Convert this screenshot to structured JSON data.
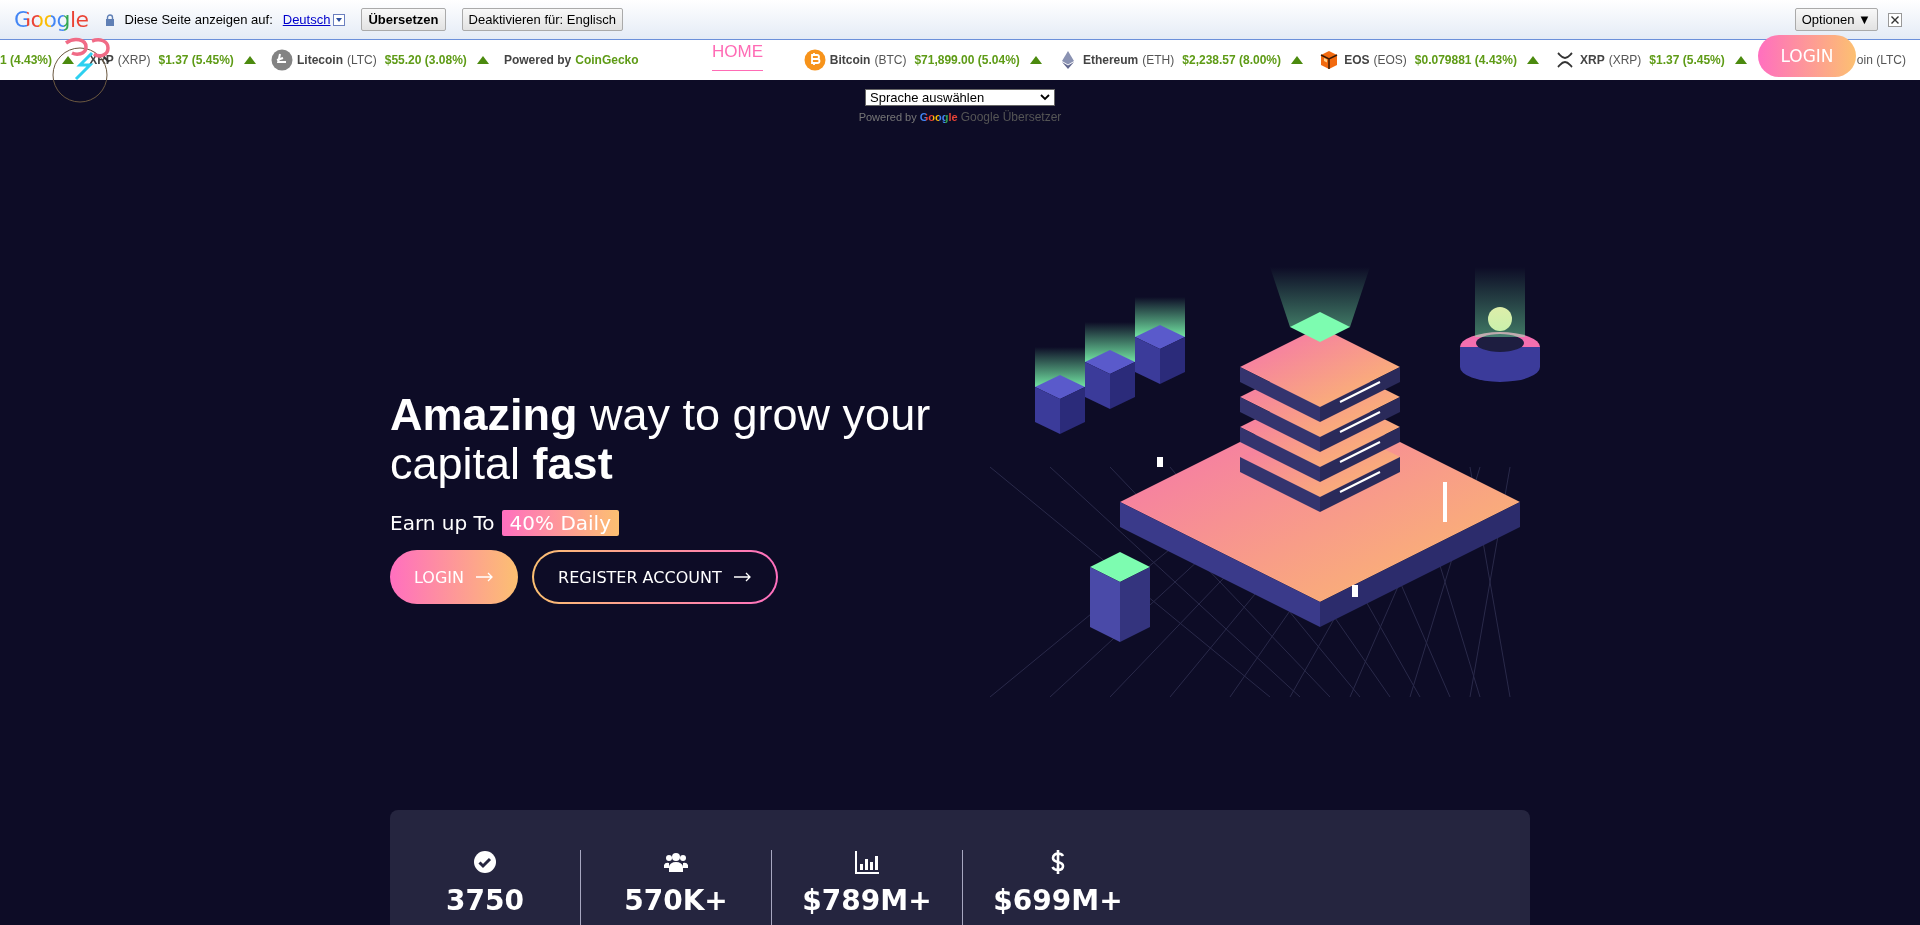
{
  "translate_bar": {
    "brand": "Google",
    "label": "Diese Seite anzeigen auf:",
    "language": "Deutsch",
    "translate_button": "Übersetzen",
    "disable_button": "Deaktivieren für: Englisch",
    "options_button": "Optionen ▼"
  },
  "ticker": [
    {
      "kind": "fragment",
      "text": "1 (4.43%)",
      "up": true
    },
    {
      "kind": "coin",
      "name": "XRP",
      "symbol": "(XRP)",
      "price": "$1.37",
      "change": "(5.45%)",
      "up": true
    },
    {
      "kind": "litecoin",
      "name": "Litecoin",
      "symbol": "(LTC)",
      "price": "$55.20",
      "change": "(3.08%)",
      "up": true
    },
    {
      "kind": "credit",
      "text": "Powered by",
      "link": "CoinGecko"
    },
    {
      "kind": "bitcoin",
      "name": "Bitcoin",
      "symbol": "(BTC)",
      "price": "$71,899.00",
      "change": "(5.04%)",
      "up": true
    },
    {
      "kind": "ethereum",
      "name": "Ethereum",
      "symbol": "(ETH)",
      "price": "$2,238.57",
      "change": "(8.00%)",
      "up": true
    },
    {
      "kind": "eos",
      "name": "EOS",
      "symbol": "(EOS)",
      "price": "$0.079881",
      "change": "(4.43%)",
      "up": true
    },
    {
      "kind": "xrp",
      "name": "XRP",
      "symbol": "(XRP)",
      "price": "$1.37",
      "change": "(5.45%)",
      "up": true
    },
    {
      "kind": "fragment",
      "text": "oin (LTC)"
    }
  ],
  "nav": {
    "items": [
      {
        "label": "HOME",
        "selected": true
      }
    ],
    "login_button": "LOGIN"
  },
  "language_widget": {
    "select": "Sprache auswählen",
    "powered_by": "Powered by",
    "brand": "Google",
    "service": "Google Übersetzer"
  },
  "hero": {
    "heading": "**Amazing** way to grow your capital **fast**",
    "earn_label": "Earn up To",
    "earn_badge": "40% Daily",
    "buttons": [
      {
        "label": "LOGIN",
        "kind": "filled"
      },
      {
        "label": "REGISTER ACCOUNT",
        "kind": "outline"
      }
    ]
  },
  "stats": [
    {
      "kind": "check",
      "value": "3750"
    },
    {
      "kind": "users",
      "value": "570K+"
    },
    {
      "kind": "chart",
      "value": "$789M+"
    },
    {
      "kind": "dollar",
      "value": "$699M+"
    }
  ]
}
